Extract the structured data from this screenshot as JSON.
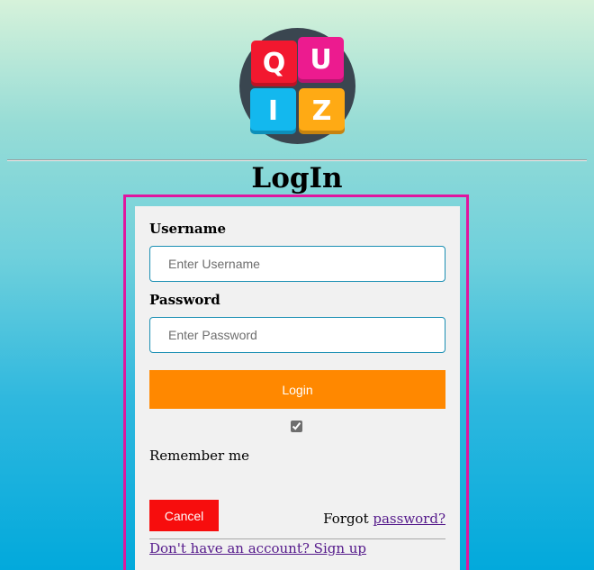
{
  "logo": {
    "tiles": [
      "Q",
      "U",
      "I",
      "Z"
    ],
    "colors": {
      "q": "#f2182f",
      "u": "#ec1b8f",
      "i": "#13b8ee",
      "z": "#ffaa14",
      "ring": "#3a4650"
    }
  },
  "page": {
    "title": "LogIn"
  },
  "form": {
    "username_label": "Username",
    "username_placeholder": "Enter Username",
    "username_value": "",
    "password_label": "Password",
    "password_placeholder": "Enter Password",
    "password_value": "",
    "login_label": "Login",
    "remember_checked": true,
    "remember_label": "Remember me",
    "cancel_label": "Cancel",
    "forgot_prefix": "Forgot ",
    "forgot_link": "password?",
    "signup_link": "Don't have an account? Sign up"
  },
  "colors": {
    "frame_border": "#e0169f",
    "login_button": "#ff8800",
    "cancel_button": "#f70d0d",
    "input_border": "#1a8fb3",
    "link": "#551a8b"
  }
}
